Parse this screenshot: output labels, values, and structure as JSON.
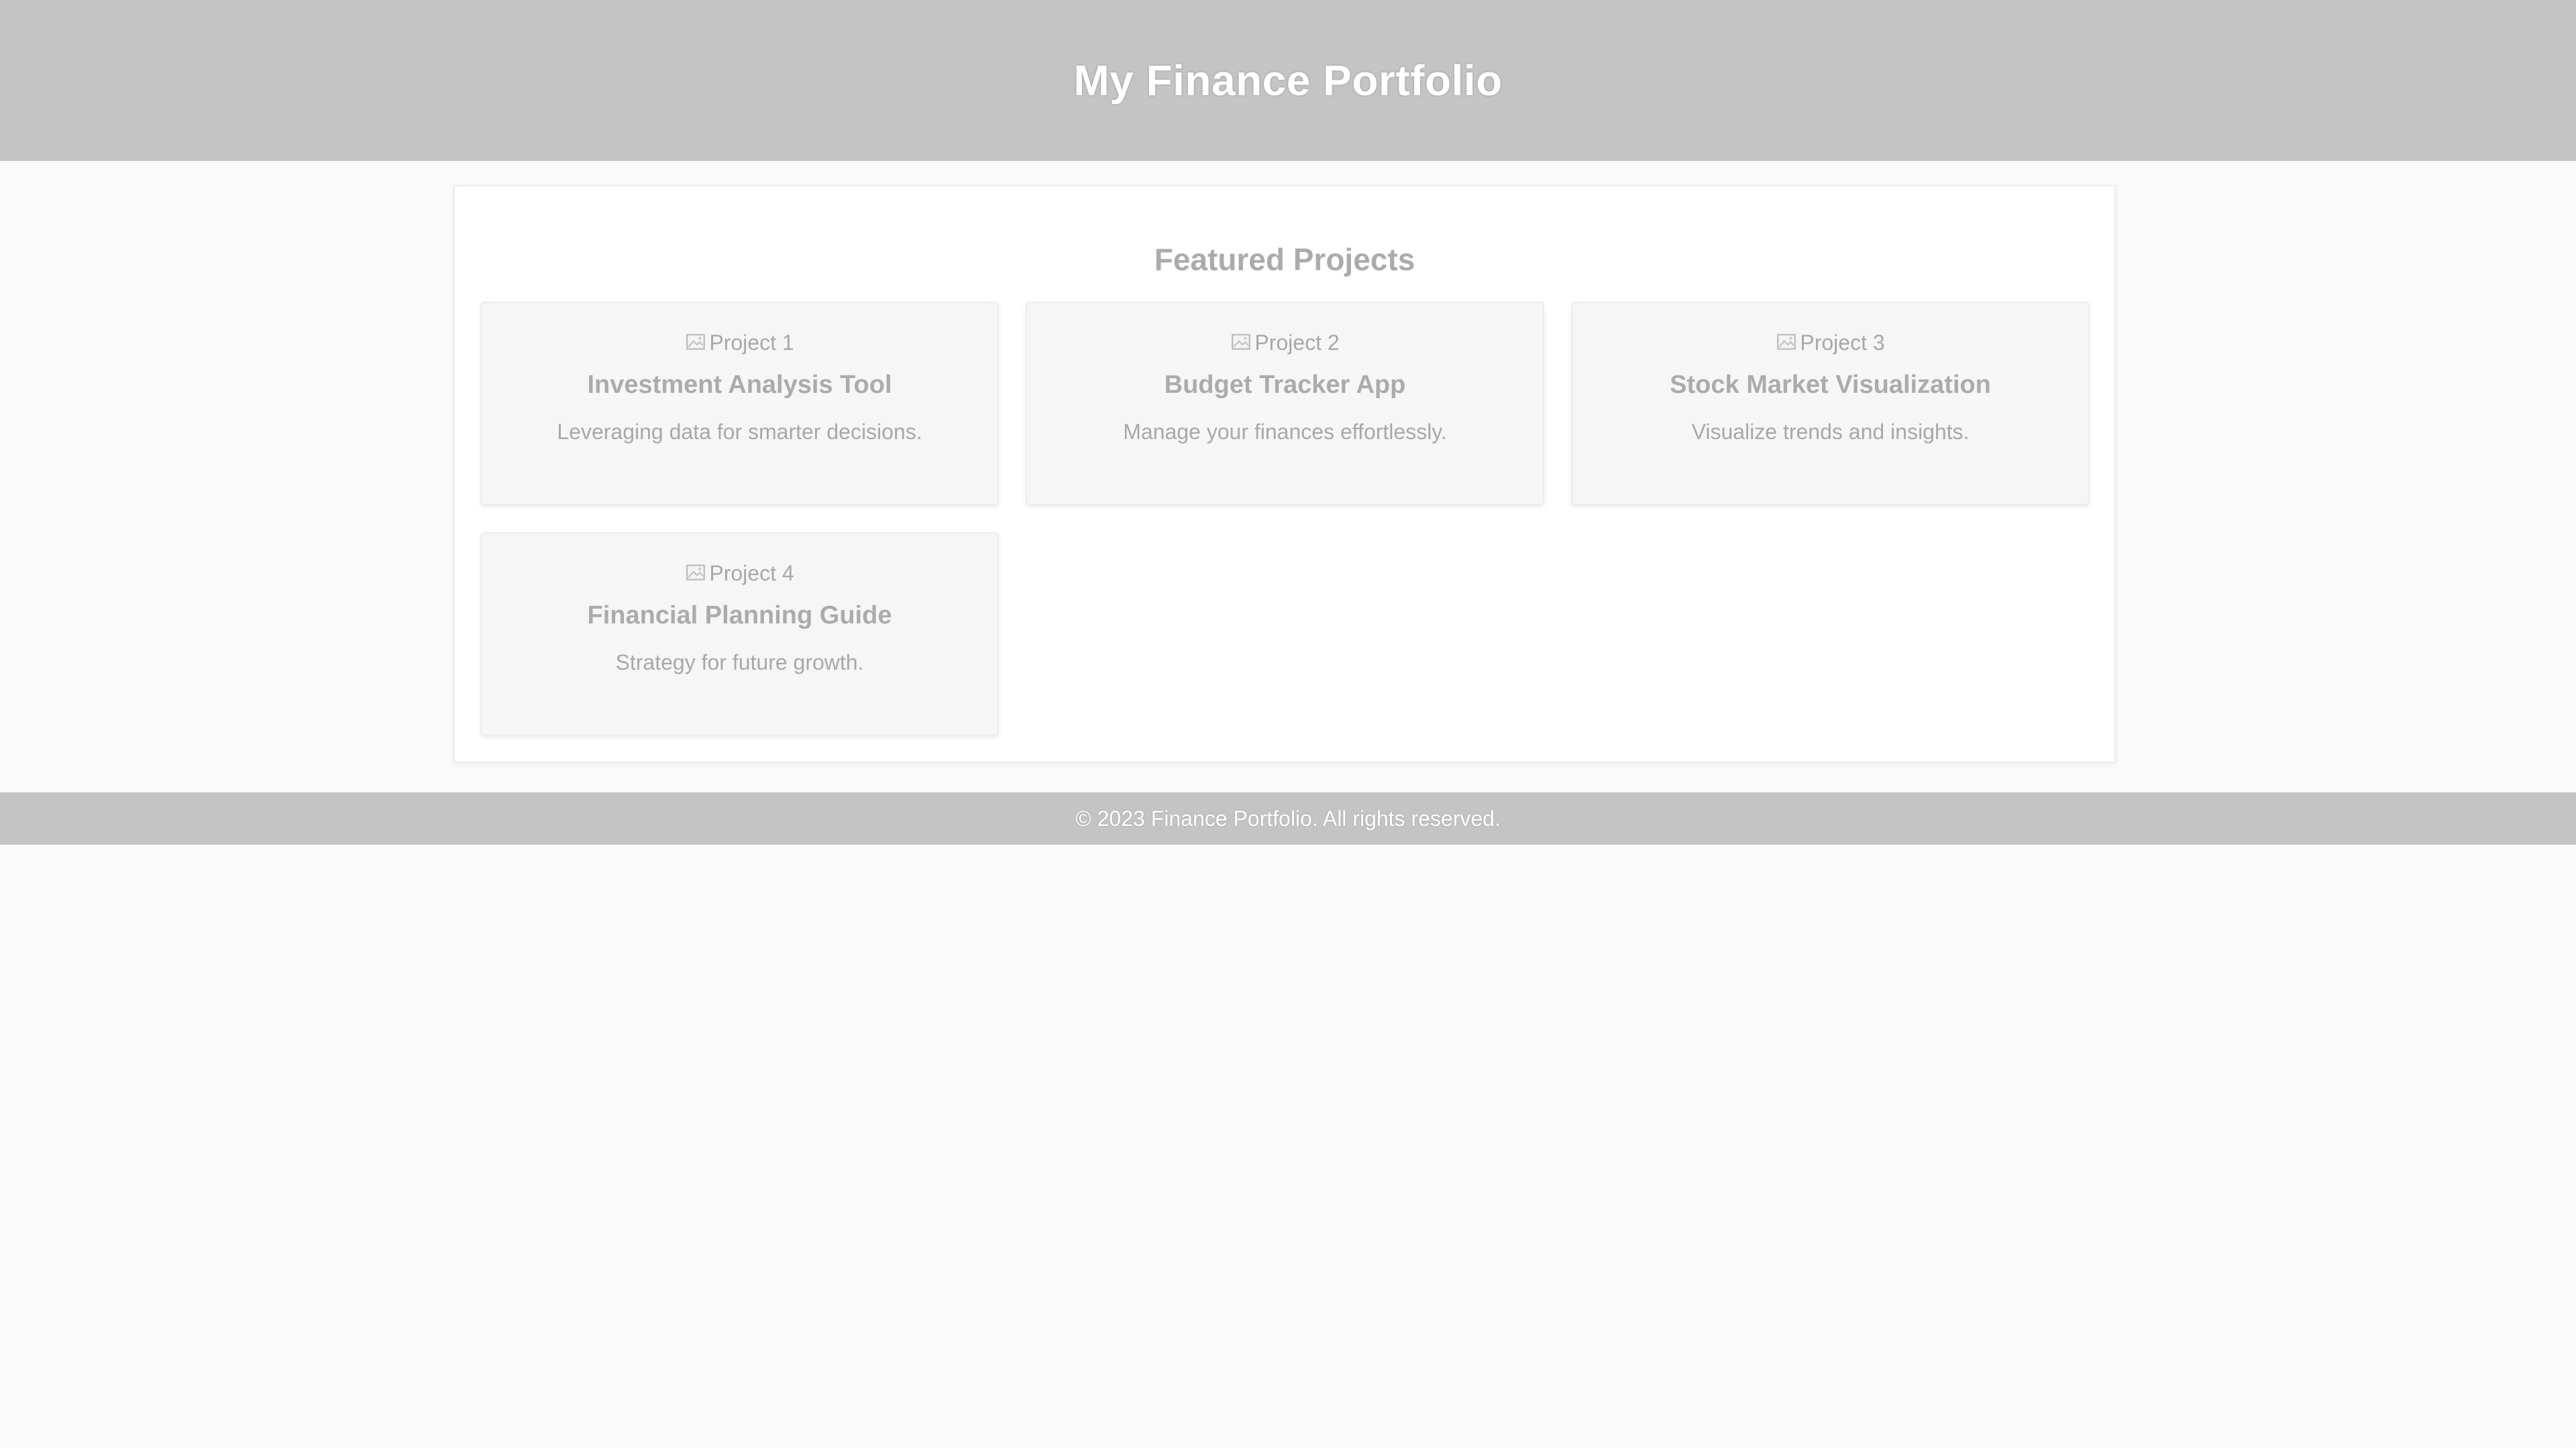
{
  "header": {
    "title": "My Finance Portfolio"
  },
  "main": {
    "section_title": "Featured Projects",
    "projects": [
      {
        "image_alt": "Project 1",
        "title": "Investment Analysis Tool",
        "description": "Leveraging data for smarter decisions."
      },
      {
        "image_alt": "Project 2",
        "title": "Budget Tracker App",
        "description": "Manage your finances effortlessly."
      },
      {
        "image_alt": "Project 3",
        "title": "Stock Market Visualization",
        "description": "Visualize trends and insights."
      },
      {
        "image_alt": "Project 4",
        "title": "Financial Planning Guide",
        "description": "Strategy for future growth."
      }
    ]
  },
  "footer": {
    "text": "© 2023 Finance Portfolio. All rights reserved."
  },
  "colors": {
    "header_bg": "#c4c4c4",
    "page_bg": "#fafafa",
    "card_bg": "#f6f6f6",
    "text_muted": "#ababab"
  },
  "icons": {
    "card_image": "broken-image-icon"
  }
}
